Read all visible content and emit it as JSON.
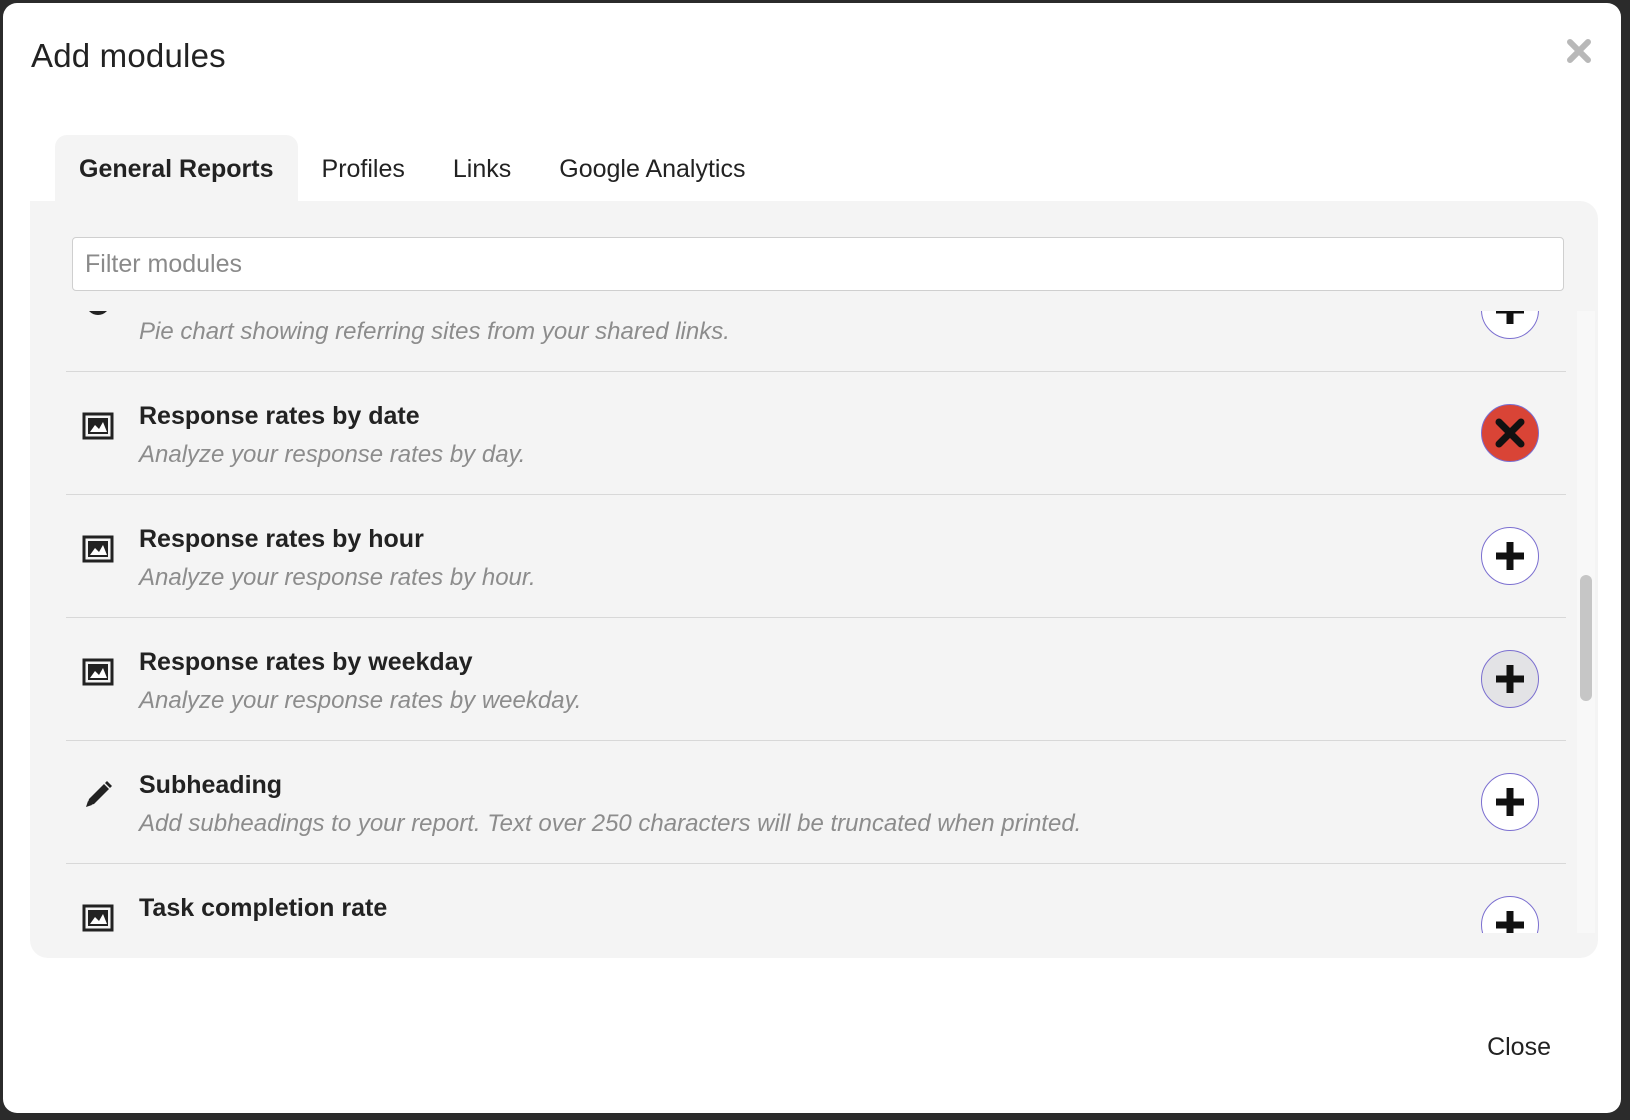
{
  "dialog": {
    "title": "Add modules",
    "close_icon": "close-icon",
    "footer_close_label": "Close"
  },
  "tabs": [
    {
      "label": "General Reports",
      "active": true
    },
    {
      "label": "Profiles",
      "active": false
    },
    {
      "label": "Links",
      "active": false
    },
    {
      "label": "Google Analytics",
      "active": false
    }
  ],
  "filter": {
    "placeholder": "Filter modules",
    "value": ""
  },
  "modules": [
    {
      "title": "",
      "description": "Pie chart showing referring sites from your shared links.",
      "icon": "pie-chart-icon",
      "state": "add"
    },
    {
      "title": "Response rates by date",
      "description": "Analyze your response rates by day.",
      "icon": "image-icon",
      "state": "remove"
    },
    {
      "title": "Response rates by hour",
      "description": "Analyze your response rates by hour.",
      "icon": "image-icon",
      "state": "add"
    },
    {
      "title": "Response rates by weekday",
      "description": "Analyze your response rates by weekday.",
      "icon": "image-icon",
      "state": "add-hover"
    },
    {
      "title": "Subheading",
      "description": "Add subheadings to your report. Text over 250 characters will be truncated when printed.",
      "icon": "pencil-icon",
      "state": "add"
    },
    {
      "title": "Task completion rate",
      "description": "",
      "icon": "image-icon",
      "state": "add"
    }
  ],
  "colors": {
    "remove_button": "#d94436",
    "button_border": "#7b6fd0",
    "panel_bg": "#f4f4f4"
  }
}
